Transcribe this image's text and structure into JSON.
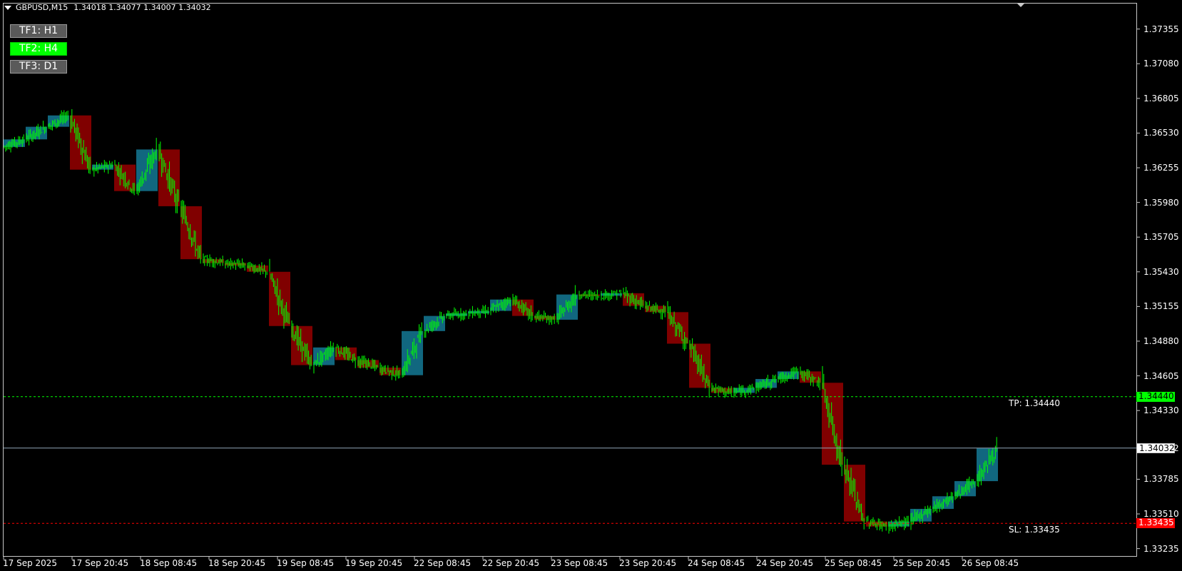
{
  "header": {
    "symbol_text": "GBPUSD,M15",
    "ohlc_text": "1.34018 1.34077 1.34007 1.34032"
  },
  "buttons": [
    {
      "label": "TF1: H1",
      "active": false
    },
    {
      "label": "TF2: H4",
      "active": true
    },
    {
      "label": "TF3: D1",
      "active": false
    }
  ],
  "colors": {
    "background": "#000000",
    "bar_color": "#00ff00",
    "bull_box": "#11677f",
    "bear_box": "#800000",
    "tp_line": "#00ff00",
    "sl_line": "#ff0000",
    "current_line": "#8fa5b8",
    "frame": "#c8c8c8"
  },
  "levels": {
    "tp": {
      "price": 1.3444,
      "label": "TP: 1.34440",
      "tag": "1.34440"
    },
    "current": {
      "price": 1.34032,
      "tag": "1.34032"
    },
    "sl": {
      "price": 1.33435,
      "label": "SL: 1.33435",
      "tag": "1.33435"
    }
  },
  "chart_data": {
    "type": "candlestick",
    "symbol": "GBPUSD",
    "timeframe": "M15",
    "y_range": [
      1.3308,
      1.3754
    ],
    "y_ticks": [
      "1.37355",
      "1.37080",
      "1.36805",
      "1.36530",
      "1.36255",
      "1.35980",
      "1.35705",
      "1.35430",
      "1.35155",
      "1.34880",
      "1.34605",
      "1.34330",
      "1.34032",
      "1.33785",
      "1.33510",
      "1.33235"
    ],
    "x_ticks": [
      "17 Sep 2025",
      "17 Sep 20:45",
      "18 Sep 08:45",
      "18 Sep 20:45",
      "19 Sep 08:45",
      "19 Sep 20:45",
      "22 Sep 08:45",
      "22 Sep 20:45",
      "23 Sep 08:45",
      "23 Sep 20:45",
      "24 Sep 08:45",
      "24 Sep 20:45",
      "25 Sep 08:45",
      "25 Sep 20:45",
      "26 Sep 08:45"
    ],
    "h4_boxes": [
      {
        "open": 1.3642,
        "close": 1.3648
      },
      {
        "open": 1.3648,
        "close": 1.3658
      },
      {
        "open": 1.3658,
        "close": 1.3667
      },
      {
        "open": 1.3667,
        "close": 1.3624
      },
      {
        "open": 1.3624,
        "close": 1.3628
      },
      {
        "open": 1.3628,
        "close": 1.3607
      },
      {
        "open": 1.3607,
        "close": 1.364
      },
      {
        "open": 1.364,
        "close": 1.3595
      },
      {
        "open": 1.3595,
        "close": 1.3553
      },
      {
        "open": 1.3553,
        "close": 1.355
      },
      {
        "open": 1.355,
        "close": 1.3548
      },
      {
        "open": 1.3548,
        "close": 1.3543
      },
      {
        "open": 1.3543,
        "close": 1.35
      },
      {
        "open": 1.35,
        "close": 1.3469
      },
      {
        "open": 1.3469,
        "close": 1.3483
      },
      {
        "open": 1.3483,
        "close": 1.3473
      },
      {
        "open": 1.3473,
        "close": 1.3467
      },
      {
        "open": 1.3467,
        "close": 1.3461
      },
      {
        "open": 1.3461,
        "close": 1.3496
      },
      {
        "open": 1.3496,
        "close": 1.3508
      },
      {
        "open": 1.3508,
        "close": 1.351
      },
      {
        "open": 1.351,
        "close": 1.3512
      },
      {
        "open": 1.3512,
        "close": 1.3521
      },
      {
        "open": 1.3521,
        "close": 1.3508
      },
      {
        "open": 1.3508,
        "close": 1.3505
      },
      {
        "open": 1.3505,
        "close": 1.3525
      },
      {
        "open": 1.3525,
        "close": 1.3524
      },
      {
        "open": 1.3524,
        "close": 1.3526
      },
      {
        "open": 1.3526,
        "close": 1.3516
      },
      {
        "open": 1.3516,
        "close": 1.3511
      },
      {
        "open": 1.3511,
        "close": 1.3486
      },
      {
        "open": 1.3486,
        "close": 1.3451
      },
      {
        "open": 1.3451,
        "close": 1.3447
      },
      {
        "open": 1.3447,
        "close": 1.3451
      },
      {
        "open": 1.3451,
        "close": 1.3458
      },
      {
        "open": 1.3458,
        "close": 1.3464
      },
      {
        "open": 1.3464,
        "close": 1.3455
      },
      {
        "open": 1.3455,
        "close": 1.339
      },
      {
        "open": 1.339,
        "close": 1.3345
      },
      {
        "open": 1.3345,
        "close": 1.3341
      },
      {
        "open": 1.3341,
        "close": 1.3345
      },
      {
        "open": 1.3345,
        "close": 1.3355
      },
      {
        "open": 1.3355,
        "close": 1.3365
      },
      {
        "open": 1.3365,
        "close": 1.3377
      },
      {
        "open": 1.3377,
        "close": 1.3403
      }
    ]
  }
}
